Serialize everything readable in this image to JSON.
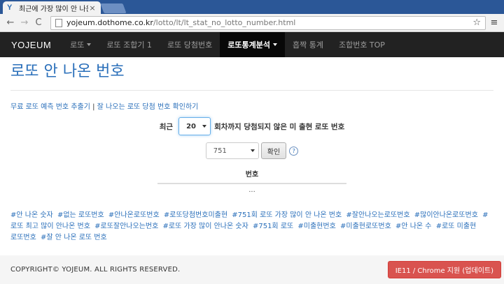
{
  "browser": {
    "tab_title": "최근에 가장 많이 안 나온",
    "tab_close": "×",
    "favicon": "Y",
    "url_domain": "yojeum.dothome.co.kr",
    "url_path": "/lotto/lt/lt_stat_no_lotto_number.html",
    "back": "←",
    "forward": "→",
    "reload": "C",
    "star": "☆",
    "menu": "≡"
  },
  "navbar": {
    "brand": "YOJEUM",
    "items": [
      {
        "label": "로또"
      },
      {
        "label": "로또 조합기 1"
      },
      {
        "label": "로또 당첨번호"
      },
      {
        "label": "로또통계분석"
      },
      {
        "label": "흡짝 통계"
      },
      {
        "label": "조합번호 TOP"
      }
    ]
  },
  "page": {
    "title": "로또 안 나온 번호",
    "link_predict": "무료 로또 예측 번호 추출기",
    "link_sep": "|",
    "link_check": "잘 나오는 로또 당첨 번호 확인하기",
    "filter_prefix": "최근",
    "filter_value": "20",
    "filter_suffix": "회차까지 당첨되지 않은 미 출현 로또 번호",
    "round_value": "751",
    "confirm_label": "확인",
    "help": "?",
    "table_header": "번호",
    "table_value": "..."
  },
  "tags": [
    "#안 나온 숫자",
    "#없는 로또번호",
    "#안나온로또번호",
    "#로또당첨번호미출현",
    "#751회 로또 가장 많이 안 나온 번호",
    "#잘안나오는로또번호",
    "#많이안나온로또번호",
    "#로또 최고 많이 안나온 번호",
    "#로또잘안나오는번호",
    "#로또 가장 많이 안나온 숫자",
    "#751회 로또",
    "#미출현번호",
    "#미출현로또번호",
    "#안 나온 수",
    "#로또 미출현",
    "로또번호",
    "#잘 안 나온 로또 번호"
  ],
  "footer": {
    "copyright": "COPYRIGHT© YOJEUM. ALL RIGHTS RESERVED.",
    "ie_button": "IE11 / Chrome 지원 (업데이트)"
  }
}
